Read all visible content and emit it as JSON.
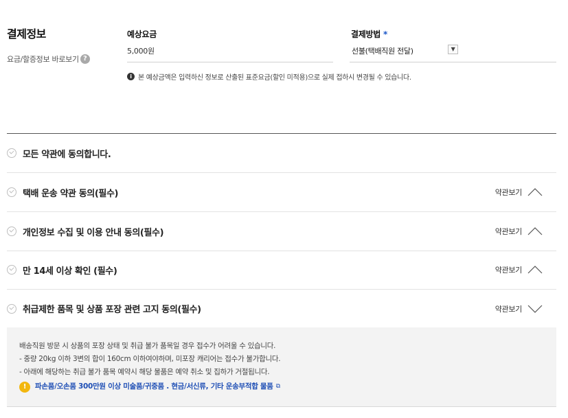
{
  "payment": {
    "title": "결제정보",
    "fee_link": "요금/할증정보 바로보기",
    "help_icon": "?",
    "fee_label": "예상요금",
    "fee_value": "5,000원",
    "method_label": "결제방법",
    "required_mark": "*",
    "method_value": "선불(택배직원 전달)",
    "notice": "본 예상금액은 입력하신 정보로 산출된 표준요금(할인 미적용)으로 실제 접하시 변경될 수 있습니다."
  },
  "agreements": {
    "all": "모든 약관에 동의합니다.",
    "view_label": "약관보기",
    "items": [
      {
        "label": "택배 운송 약관 동의(필수)",
        "expanded": false
      },
      {
        "label": "개인정보 수집 및 이용 안내 동의(필수)",
        "expanded": false
      },
      {
        "label": "만 14세 이상 확인 (필수)",
        "expanded": false
      },
      {
        "label": "취급제한 품목 및 상품 포장 관련 고지 동의(필수)",
        "expanded": true
      }
    ]
  },
  "detail": {
    "line1": "배송직원 방문 시 상품의 포장 상태 및 취급 불가 품목일 경우 접수가 어려울 수 있습니다.",
    "line2": " - 중량 20kg 이하 3변의 합이 160cm 이하여야하며, 미포장 캐리어는 접수가 불가합니다.",
    "line3": " - 아래에 해당하는 취급 불가 품목 예약시 해당 물품은 예약 취소 및 집하가 거절됩니다.",
    "link": "파손품/오손품 300만원 이상 미술품/귀중품 . 현금/서신류, 기타 운송부적합 물품",
    "warn_icon": "!"
  },
  "colors": {
    "accent_blue": "#1a56c8",
    "link_blue": "#1f4fb5",
    "warning_yellow": "#f2b70f"
  },
  "icons": {
    "help": "question-circle-icon",
    "info": "info-circle-icon",
    "check": "check-circle-icon",
    "chevron_up": "chevron-up-icon",
    "chevron_down": "chevron-down-icon",
    "warning": "warning-circle-icon",
    "external": "external-link-icon"
  }
}
